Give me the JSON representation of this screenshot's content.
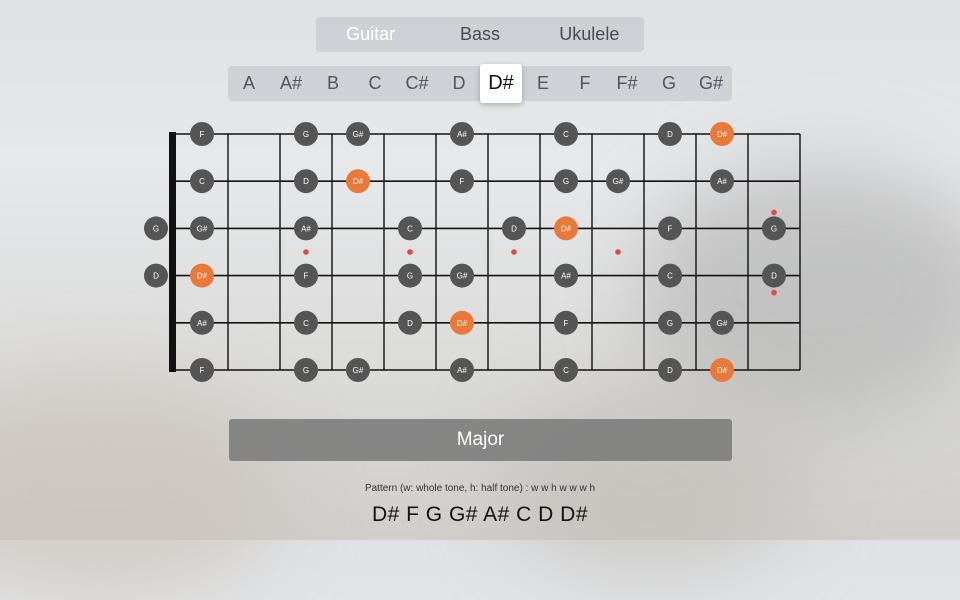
{
  "instruments": [
    {
      "label": "Guitar",
      "active": true
    },
    {
      "label": "Bass",
      "active": false
    },
    {
      "label": "Ukulele",
      "active": false
    }
  ],
  "keys": [
    {
      "label": "A",
      "selected": false
    },
    {
      "label": "A#",
      "selected": false
    },
    {
      "label": "B",
      "selected": false
    },
    {
      "label": "C",
      "selected": false
    },
    {
      "label": "C#",
      "selected": false
    },
    {
      "label": "D",
      "selected": false
    },
    {
      "label": "D#",
      "selected": true
    },
    {
      "label": "E",
      "selected": false
    },
    {
      "label": "F",
      "selected": false
    },
    {
      "label": "F#",
      "selected": false
    },
    {
      "label": "G",
      "selected": false
    },
    {
      "label": "G#",
      "selected": false
    }
  ],
  "fretboard": {
    "frets": 12,
    "strings": 6,
    "fret_markers_single": [
      3,
      5,
      7,
      9
    ],
    "fret_markers_double": [
      12
    ],
    "open_string_notes": [
      {
        "string": 3,
        "note": "G"
      },
      {
        "string": 4,
        "note": "D"
      }
    ],
    "notes": [
      {
        "string": 1,
        "fret": 1,
        "note": "F"
      },
      {
        "string": 1,
        "fret": 3,
        "note": "G"
      },
      {
        "string": 1,
        "fret": 4,
        "note": "G#"
      },
      {
        "string": 1,
        "fret": 6,
        "note": "A#"
      },
      {
        "string": 1,
        "fret": 8,
        "note": "C"
      },
      {
        "string": 1,
        "fret": 10,
        "note": "D"
      },
      {
        "string": 1,
        "fret": 11,
        "note": "D#",
        "root": true
      },
      {
        "string": 2,
        "fret": 1,
        "note": "C"
      },
      {
        "string": 2,
        "fret": 3,
        "note": "D"
      },
      {
        "string": 2,
        "fret": 4,
        "note": "D#",
        "root": true
      },
      {
        "string": 2,
        "fret": 6,
        "note": "F"
      },
      {
        "string": 2,
        "fret": 8,
        "note": "G"
      },
      {
        "string": 2,
        "fret": 9,
        "note": "G#"
      },
      {
        "string": 2,
        "fret": 11,
        "note": "A#"
      },
      {
        "string": 3,
        "fret": 1,
        "note": "G#"
      },
      {
        "string": 3,
        "fret": 3,
        "note": "A#"
      },
      {
        "string": 3,
        "fret": 5,
        "note": "C"
      },
      {
        "string": 3,
        "fret": 7,
        "note": "D"
      },
      {
        "string": 3,
        "fret": 8,
        "note": "D#",
        "root": true
      },
      {
        "string": 3,
        "fret": 10,
        "note": "F"
      },
      {
        "string": 3,
        "fret": 12,
        "note": "G"
      },
      {
        "string": 4,
        "fret": 1,
        "note": "D#",
        "root": true
      },
      {
        "string": 4,
        "fret": 3,
        "note": "F"
      },
      {
        "string": 4,
        "fret": 5,
        "note": "G"
      },
      {
        "string": 4,
        "fret": 6,
        "note": "G#"
      },
      {
        "string": 4,
        "fret": 8,
        "note": "A#"
      },
      {
        "string": 4,
        "fret": 10,
        "note": "C"
      },
      {
        "string": 4,
        "fret": 12,
        "note": "D"
      },
      {
        "string": 5,
        "fret": 1,
        "note": "A#"
      },
      {
        "string": 5,
        "fret": 3,
        "note": "C"
      },
      {
        "string": 5,
        "fret": 5,
        "note": "D"
      },
      {
        "string": 5,
        "fret": 6,
        "note": "D#",
        "root": true
      },
      {
        "string": 5,
        "fret": 8,
        "note": "F"
      },
      {
        "string": 5,
        "fret": 10,
        "note": "G"
      },
      {
        "string": 5,
        "fret": 11,
        "note": "G#"
      },
      {
        "string": 6,
        "fret": 1,
        "note": "F"
      },
      {
        "string": 6,
        "fret": 3,
        "note": "G"
      },
      {
        "string": 6,
        "fret": 4,
        "note": "G#"
      },
      {
        "string": 6,
        "fret": 6,
        "note": "A#"
      },
      {
        "string": 6,
        "fret": 8,
        "note": "C"
      },
      {
        "string": 6,
        "fret": 10,
        "note": "D"
      },
      {
        "string": 6,
        "fret": 11,
        "note": "D#",
        "root": true
      }
    ]
  },
  "scale_button_label": "Major",
  "pattern_text": "Pattern (w: whole tone, h: half tone) : w w h w w w h",
  "scale_notes_text": "D# F G G# A# C D D#",
  "colors": {
    "note_fill": "#555555",
    "root_fill": "#e8793a",
    "marker": "#e24a3b",
    "line": "#111111"
  }
}
